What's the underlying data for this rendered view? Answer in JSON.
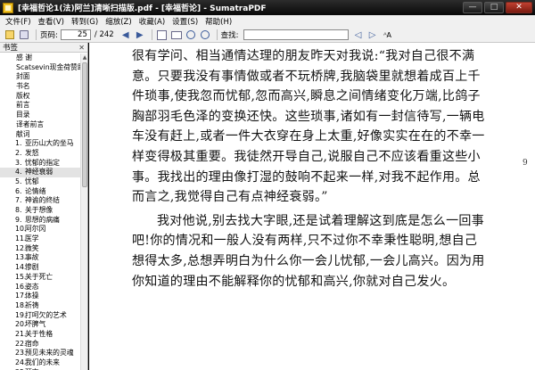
{
  "window": {
    "title": "[幸福哲论1(法)阿兰]清晰扫描版.pdf - [幸福哲论] - SumatraPDF",
    "buttons": {
      "minimize": "—",
      "maximize": "□",
      "close": "✕"
    }
  },
  "menu": [
    "文件(F)",
    "查看(V)",
    "转到(G)",
    "缩放(Z)",
    "收藏(A)",
    "设置(S)",
    "帮助(H)"
  ],
  "toolbar": {
    "page_label": "页码:",
    "current_page": "25",
    "total_pages": "/ 242",
    "search_label": "查找:",
    "search_value": "",
    "font_size_toggle": "ᴬA",
    "icons": [
      "open-icon",
      "print-icon",
      "prev-page-icon",
      "next-page-icon",
      "fit-page-icon",
      "fit-width-icon",
      "zoom-out-icon",
      "zoom-in-icon",
      "find-prev-icon",
      "find-next-icon"
    ]
  },
  "sidebar": {
    "header": "书签",
    "close": "✕",
    "items": [
      {
        "num": "",
        "label": "感 谢",
        "level": 0
      },
      {
        "num": "",
        "label": "Scatsevin现金荷赞助",
        "level": 0
      },
      {
        "num": "",
        "label": "封面",
        "level": 0
      },
      {
        "num": "",
        "label": "书名",
        "level": 0
      },
      {
        "num": "",
        "label": "版权",
        "level": 0
      },
      {
        "num": "",
        "label": "前言",
        "level": 0
      },
      {
        "num": "",
        "label": "目录",
        "level": 0
      },
      {
        "num": "",
        "label": "译者前言",
        "level": 0
      },
      {
        "num": "",
        "label": "献词",
        "level": 0
      },
      {
        "num": "1.",
        "label": "亚历山大的坐马",
        "level": 1
      },
      {
        "num": "2.",
        "label": "发怒",
        "level": 1
      },
      {
        "num": "3.",
        "label": "忧郁的指定",
        "level": 1
      },
      {
        "num": "4.",
        "label": "神经衰弱",
        "level": 1,
        "selected": true
      },
      {
        "num": "5.",
        "label": "忧郁",
        "level": 1
      },
      {
        "num": "6.",
        "label": "论情绪",
        "level": 1
      },
      {
        "num": "7.",
        "label": "神谕的终结",
        "level": 1
      },
      {
        "num": "8.",
        "label": "关于想像",
        "level": 1
      },
      {
        "num": "9.",
        "label": "思想的病痛",
        "level": 1
      },
      {
        "num": "10.",
        "label": "阿尔冈",
        "level": 1
      },
      {
        "num": "11.",
        "label": "医学",
        "level": 1
      },
      {
        "num": "12.",
        "label": "微笑",
        "level": 1
      },
      {
        "num": "13.",
        "label": "事故",
        "level": 1
      },
      {
        "num": "14.",
        "label": "惨剧",
        "level": 1
      },
      {
        "num": "15.",
        "label": "关于死亡",
        "level": 1
      },
      {
        "num": "16.",
        "label": "姿态",
        "level": 1
      },
      {
        "num": "17.",
        "label": "体操",
        "level": 1
      },
      {
        "num": "18.",
        "label": "祈祷",
        "level": 1
      },
      {
        "num": "19.",
        "label": "打呵欠的艺术",
        "level": 1
      },
      {
        "num": "20.",
        "label": "坏脾气",
        "level": 1
      },
      {
        "num": "21.",
        "label": "关于性格",
        "level": 1
      },
      {
        "num": "22.",
        "label": "宿命",
        "level": 1
      },
      {
        "num": "23.",
        "label": "预见未来的灵魂",
        "level": 1
      },
      {
        "num": "24.",
        "label": "我们的未来",
        "level": 1
      },
      {
        "num": "25.",
        "label": "预言",
        "level": 1
      }
    ]
  },
  "document": {
    "paragraphs": [
      {
        "text": "很有学问、相当通情达理的朋友昨天对我说:“我对自己很不满意。只要我没有事情做或者不玩桥牌,我脑袋里就想着成百上千件琐事,使我忽而忧郁,忽而高兴,瞬息之间情绪变化万端,比鸽子胸部羽毛色泽的变换还快。这些琐事,诸如有一封信待写,一辆电车没有赶上,或者一件大衣穿在身上太重,好像实实在在的不幸一样变得极其重要。我徒然开导自己,说服自己不应该看重这些小事。我找出的理由像打湿的鼓响不起来一样,对我不起作用。总而言之,我觉得自己有点神经衰弱。”",
        "indent": false
      },
      {
        "text": "我对他说,别去找大字眼,还是试着理解这到底是怎么一回事吧!你的情况和一般人没有两样,只不过你不幸秉性聪明,想自己想得太多,总想弄明白为什么你一会儿忧郁,一会儿高兴。因为用你知道的理由不能解释你的忧郁和高兴,你就对自己发火。",
        "indent": true
      }
    ],
    "margin_mark": "9"
  }
}
